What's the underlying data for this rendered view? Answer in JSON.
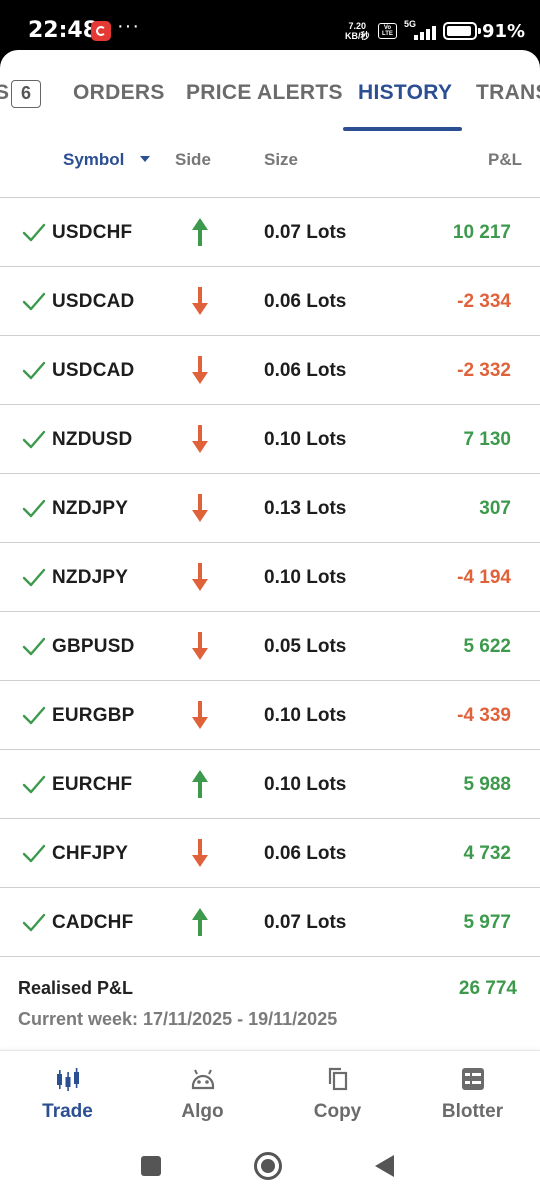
{
  "status_bar": {
    "time": "22:48",
    "more": "···",
    "net_speed_value": "7.20",
    "net_speed_unit": "KB/秒",
    "volte": "Vo LTE",
    "network": "5G",
    "battery": "91%"
  },
  "tabs": {
    "partial_left_label": "S",
    "badge_count": "6",
    "items": [
      {
        "label": "ORDERS",
        "active": false
      },
      {
        "label": "PRICE ALERTS",
        "active": false
      },
      {
        "label": "HISTORY",
        "active": true
      },
      {
        "label": "TRANS",
        "active": false
      }
    ]
  },
  "columns": {
    "symbol": "Symbol",
    "side": "Side",
    "size": "Size",
    "pnl": "P&L"
  },
  "trades": [
    {
      "symbol": "USDCHF",
      "side": "buy",
      "size": "0.07 Lots",
      "pnl": "10 217",
      "pnl_sign": "positive"
    },
    {
      "symbol": "USDCAD",
      "side": "sell",
      "size": "0.06 Lots",
      "pnl": "-2 334",
      "pnl_sign": "negative"
    },
    {
      "symbol": "USDCAD",
      "side": "sell",
      "size": "0.06 Lots",
      "pnl": "-2 332",
      "pnl_sign": "negative"
    },
    {
      "symbol": "NZDUSD",
      "side": "sell",
      "size": "0.10 Lots",
      "pnl": "7 130",
      "pnl_sign": "positive"
    },
    {
      "symbol": "NZDJPY",
      "side": "sell",
      "size": "0.13 Lots",
      "pnl": "307",
      "pnl_sign": "positive"
    },
    {
      "symbol": "NZDJPY",
      "side": "sell",
      "size": "0.10 Lots",
      "pnl": "-4 194",
      "pnl_sign": "negative"
    },
    {
      "symbol": "GBPUSD",
      "side": "sell",
      "size": "0.05 Lots",
      "pnl": "5 622",
      "pnl_sign": "positive"
    },
    {
      "symbol": "EURGBP",
      "side": "sell",
      "size": "0.10 Lots",
      "pnl": "-4 339",
      "pnl_sign": "negative"
    },
    {
      "symbol": "EURCHF",
      "side": "buy",
      "size": "0.10 Lots",
      "pnl": "5 988",
      "pnl_sign": "positive"
    },
    {
      "symbol": "CHFJPY",
      "side": "sell",
      "size": "0.06 Lots",
      "pnl": "4 732",
      "pnl_sign": "positive"
    },
    {
      "symbol": "CADCHF",
      "side": "buy",
      "size": "0.07 Lots",
      "pnl": "5 977",
      "pnl_sign": "positive"
    }
  ],
  "summary": {
    "label": "Realised P&L",
    "value": "26 774",
    "week": "Current week: 17/11/2025 - 19/11/2025"
  },
  "bottom_nav": [
    {
      "label": "Trade",
      "icon": "candlestick-icon",
      "active": true
    },
    {
      "label": "Algo",
      "icon": "robot-icon",
      "active": false
    },
    {
      "label": "Copy",
      "icon": "copy-icon",
      "active": false
    },
    {
      "label": "Blotter",
      "icon": "blotter-icon",
      "active": false
    }
  ],
  "colors": {
    "accent": "#2b4f92",
    "positive": "#3d9a4c",
    "negative": "#e0623a",
    "buy_arrow": "#3d9a4c",
    "sell_arrow": "#e0623a"
  }
}
